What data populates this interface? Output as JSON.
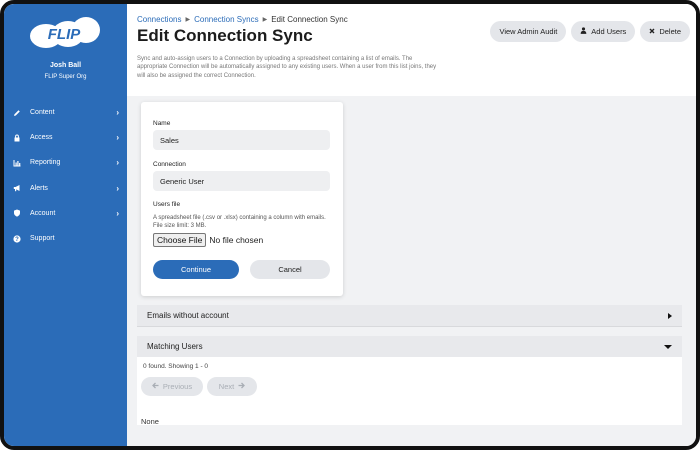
{
  "sidebar": {
    "logo_text": "FLIP",
    "user_name": "Josh Ball",
    "org_name": "FLIP Super Org",
    "items": [
      {
        "label": "Content",
        "icon": "pencil-icon",
        "has_chevron": true
      },
      {
        "label": "Access",
        "icon": "lock-icon",
        "has_chevron": true
      },
      {
        "label": "Reporting",
        "icon": "bar-chart-icon",
        "has_chevron": true
      },
      {
        "label": "Alerts",
        "icon": "megaphone-icon",
        "has_chevron": true
      },
      {
        "label": "Account",
        "icon": "shield-icon",
        "has_chevron": true
      },
      {
        "label": "Support",
        "icon": "question-circle-icon",
        "has_chevron": false
      }
    ],
    "chevron_glyph": "›"
  },
  "breadcrumb": {
    "items": [
      "Connections",
      "Connection Syncs"
    ],
    "current": "Edit Connection Sync",
    "separator": "▶"
  },
  "page": {
    "title": "Edit Connection Sync",
    "description": "Sync and auto-assign users to a Connection by uploading a spreadsheet containing a list of emails. The appropriate Connection will be automatically assigned to any existing users. When a user from this list joins, they will also be assigned the correct Connection."
  },
  "actions": {
    "view_admin_audit": "View Admin Audit",
    "add_users": "Add Users",
    "delete": "Delete"
  },
  "form": {
    "name_label": "Name",
    "name_value": "Sales",
    "connection_label": "Connection",
    "connection_value": "Generic User",
    "users_file_label": "Users file",
    "users_file_help": "A spreadsheet file (.csv or .xlsx) containing a column with emails. File size limit: 3 MB.",
    "choose_file_label": "Choose File",
    "no_file_text": "No file chosen",
    "continue_label": "Continue",
    "cancel_label": "Cancel"
  },
  "panels": {
    "emails_without_account": "Emails without account",
    "matching_users": "Matching Users",
    "found_text": "0 found. Showing 1 - 0",
    "previous_label": "Previous",
    "next_label": "Next",
    "none_text": "None"
  },
  "colors": {
    "sidebar": "#2b6cb8",
    "accent": "#2b6cb8",
    "background": "#f1f2f4"
  }
}
